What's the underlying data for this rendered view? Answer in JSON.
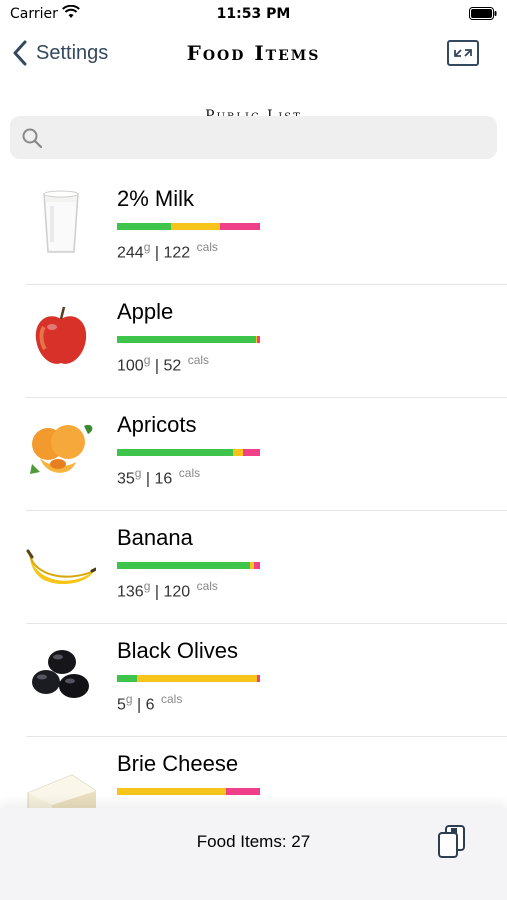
{
  "status_bar": {
    "carrier": "Carrier",
    "time": "11:53 PM"
  },
  "nav": {
    "back_label": "Settings",
    "title": "Food Items"
  },
  "section_header": "Public List",
  "search": {
    "placeholder": ""
  },
  "foods": [
    {
      "name": "2% Milk",
      "grams": "244",
      "cals": "122",
      "image": "milk-glass",
      "macros": {
        "carb": 0.38,
        "fat": 0.34,
        "protein": 0.28
      }
    },
    {
      "name": "Apple",
      "grams": "100",
      "cals": "52",
      "image": "red-apple",
      "macros": {
        "carb": 0.97,
        "fat": 0.01,
        "protein": 0.02
      }
    },
    {
      "name": "Apricots",
      "grams": "35",
      "cals": "16",
      "image": "apricots",
      "macros": {
        "carb": 0.81,
        "fat": 0.07,
        "protein": 0.12
      }
    },
    {
      "name": "Banana",
      "grams": "136",
      "cals": "120",
      "image": "banana",
      "macros": {
        "carb": 0.93,
        "fat": 0.03,
        "protein": 0.04
      }
    },
    {
      "name": "Black Olives",
      "grams": "5",
      "cals": "6",
      "image": "black-olives",
      "macros": {
        "carb": 0.14,
        "fat": 0.84,
        "protein": 0.02
      }
    },
    {
      "name": "Brie Cheese",
      "grams": "",
      "cals": "",
      "image": "brie-cheese",
      "macros": {
        "carb": 0.0,
        "fat": 0.76,
        "protein": 0.24
      }
    }
  ],
  "footer": {
    "count_label": "Food Items: 27"
  },
  "colors": {
    "carb": "#3ec44b",
    "fat": "#f7c41c",
    "protein": "#f0408a",
    "nav_text": "#34495e"
  },
  "units": {
    "grams": "g",
    "cals": "cals"
  }
}
